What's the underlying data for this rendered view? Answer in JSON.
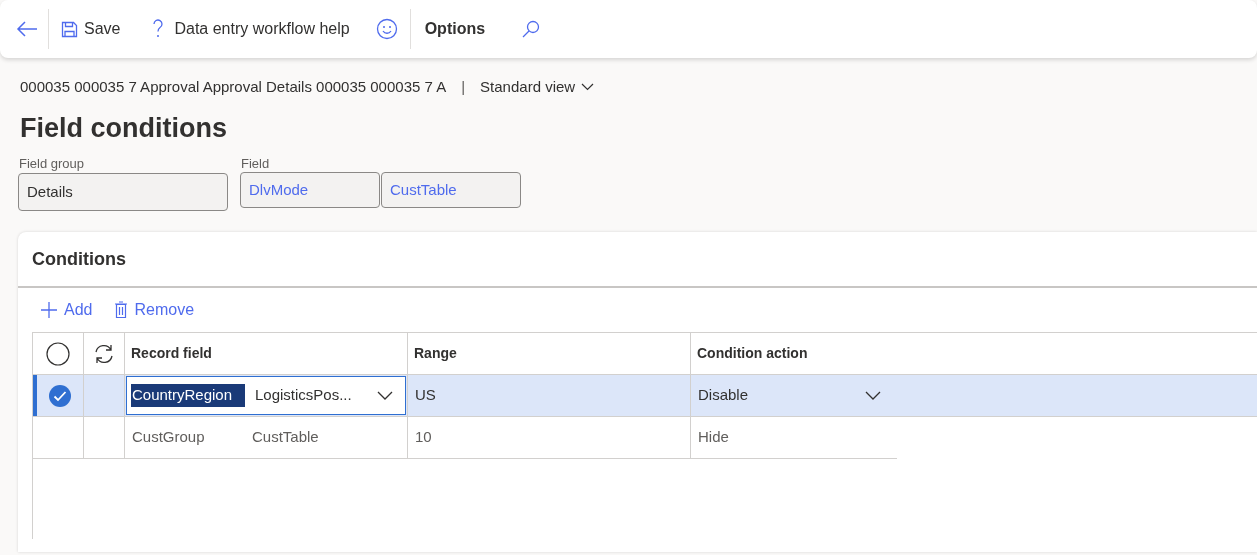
{
  "toolbar": {
    "buttons": [
      {
        "kind": "save",
        "label": "Save"
      },
      {
        "kind": "help",
        "label": "Data entry workflow help"
      },
      {
        "kind": "feedback"
      },
      {
        "kind": "options",
        "label": "Options"
      },
      {
        "kind": "search"
      }
    ]
  },
  "breadcrumb": "000035 000035 7 Approval Approval Details 000035 000035 7 A",
  "separator": "|",
  "view": "Standard view",
  "title": "Field conditions",
  "field_group": {
    "label": "Field group",
    "value": "Details"
  },
  "field": {
    "label": "Field",
    "values": [
      "DlvMode",
      "CustTable"
    ]
  },
  "conditions": {
    "title": "Conditions",
    "actions": [
      {
        "kind": "add",
        "label": "Add"
      },
      {
        "kind": "remove",
        "label": "Remove"
      }
    ],
    "select_all": {
      "checked": false
    },
    "columns": [
      "Record field",
      "Range",
      "Condition action"
    ],
    "rows": [
      {
        "selected": true,
        "field": "CountryRegion",
        "table": "LogisticsPos...",
        "range": "US",
        "action": "Disable"
      },
      {
        "selected": false,
        "field": "CustGroup",
        "table": "CustTable",
        "range": "10",
        "action": "Hide"
      }
    ]
  }
}
